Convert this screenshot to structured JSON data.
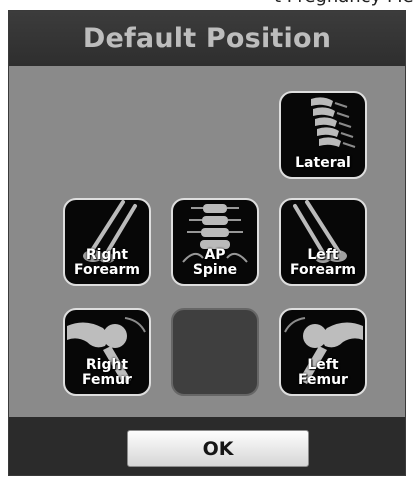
{
  "page": {
    "caption_fragment": "t Pregnancy Messages"
  },
  "dialog": {
    "title": "Default Position",
    "ok_label": "OK"
  },
  "positions": {
    "lateral": {
      "label": "Lateral",
      "icon": "lateral-spine-xray-icon"
    },
    "right_forearm": {
      "line1": "Right",
      "line2": "Forearm",
      "icon": "right-forearm-xray-icon"
    },
    "ap_spine": {
      "line1": "AP",
      "line2": "Spine",
      "icon": "ap-spine-xray-icon"
    },
    "left_forearm": {
      "line1": "Left",
      "line2": "Forearm",
      "icon": "left-forearm-xray-icon"
    },
    "right_femur": {
      "line1": "Right",
      "line2": "Femur",
      "icon": "right-femur-xray-icon"
    },
    "left_femur": {
      "line1": "Left",
      "line2": "Femur",
      "icon": "left-femur-xray-icon"
    }
  },
  "colors": {
    "panel": "#8a8a8a",
    "title_bar": "#333333",
    "title_text": "#bdbdbd",
    "tile_border": "#dedede",
    "tile_bg": "#070707",
    "footer": "#2b2b2b"
  }
}
